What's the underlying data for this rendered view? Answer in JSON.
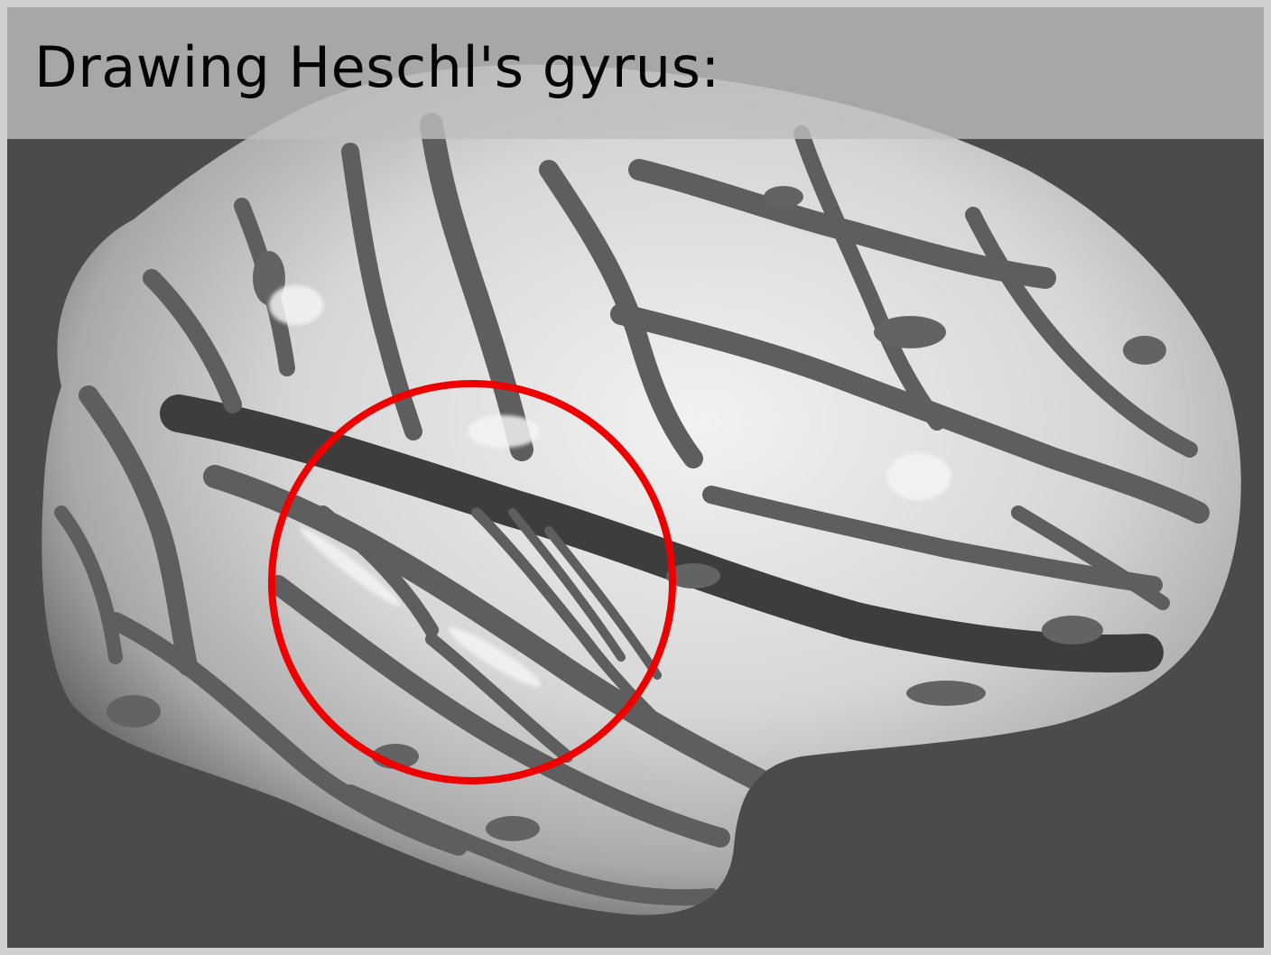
{
  "title": "Drawing Heschl's gyrus:",
  "colors": {
    "background": "#4b4b4e",
    "frame": "#cfcfcf",
    "banner": "#bebebe",
    "gyrus": "#e2e2e2",
    "sulcus": "#5e5e5e",
    "highlight_circle": "#ee0000"
  },
  "view": {
    "surface": "inflated cortical surface",
    "hemisphere_view": "lateral"
  }
}
